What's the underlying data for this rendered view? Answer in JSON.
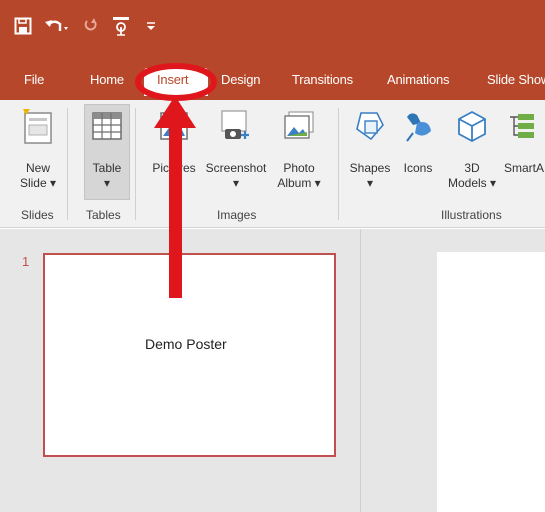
{
  "quick_access": {
    "icons": [
      "save-icon",
      "undo-icon",
      "redo-icon",
      "touch-mode-icon",
      "customize-qat-icon"
    ]
  },
  "tabs": [
    {
      "label": "File"
    },
    {
      "label": "Home"
    },
    {
      "label": "Insert",
      "active": true
    },
    {
      "label": "Design"
    },
    {
      "label": "Transitions"
    },
    {
      "label": "Animations"
    },
    {
      "label": "Slide Show"
    }
  ],
  "ribbon": {
    "groups": [
      {
        "label": "Slides"
      },
      {
        "label": "Tables"
      },
      {
        "label": "Images"
      },
      {
        "label": "Illustrations"
      }
    ],
    "buttons": {
      "new_slide": {
        "line1": "New",
        "line2": "Slide ▾"
      },
      "table": {
        "line1": "Table",
        "line2": "▾"
      },
      "pictures": {
        "line1": "Pictures"
      },
      "screenshot": {
        "line1": "Screenshot",
        "line2": "▾"
      },
      "photo_album": {
        "line1": "Photo",
        "line2": "Album ▾"
      },
      "shapes": {
        "line1": "Shapes",
        "line2": "▾"
      },
      "icons": {
        "line1": "Icons"
      },
      "models_3d": {
        "line1": "3D",
        "line2": "Models ▾"
      },
      "smartart": {
        "line1": "SmartA"
      }
    }
  },
  "slides_pane": {
    "slides": [
      {
        "number": "1",
        "text": "Demo Poster"
      }
    ]
  },
  "colors": {
    "title_bar": "#b7472a",
    "annotation": "#e0161d",
    "thumb_border": "#c0504d"
  }
}
